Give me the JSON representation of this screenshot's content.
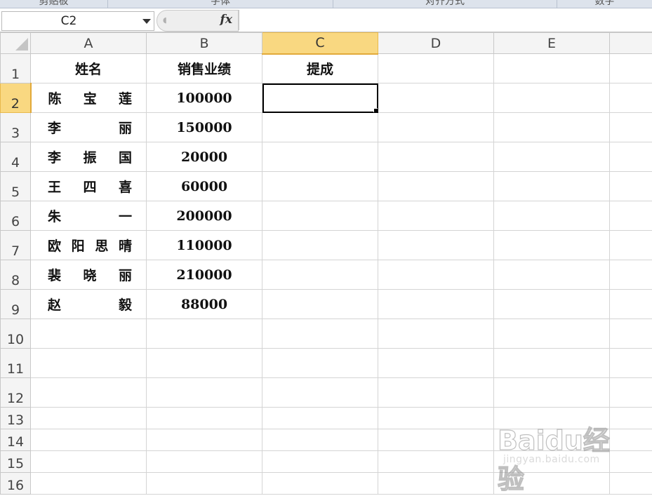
{
  "ribbon": {
    "groups": [
      "剪贴板",
      "字体",
      "对齐方式",
      "数字"
    ]
  },
  "formula_bar": {
    "name_box": "C2",
    "fx_label": "fx",
    "formula": ""
  },
  "grid": {
    "columns": [
      "A",
      "B",
      "C",
      "D",
      "E"
    ],
    "rows": [
      "1",
      "2",
      "3",
      "4",
      "5",
      "6",
      "7",
      "8",
      "9",
      "10",
      "11",
      "12",
      "13",
      "14",
      "15",
      "16"
    ],
    "active_cell": "C2",
    "header_row": {
      "name": "姓名",
      "sales": "销售业绩",
      "commission": "提成"
    },
    "data": [
      {
        "name": "陈宝莲",
        "sales": "100000"
      },
      {
        "name": "李丽",
        "sales": "150000"
      },
      {
        "name": "李振国",
        "sales": "20000"
      },
      {
        "name": "王四喜",
        "sales": "60000"
      },
      {
        "name": "朱一",
        "sales": "200000"
      },
      {
        "name": "欧阳思晴",
        "sales": "110000"
      },
      {
        "name": "裴晓丽",
        "sales": "210000"
      },
      {
        "name": "赵毅",
        "sales": "88000"
      }
    ]
  },
  "watermark": {
    "brand": "Baidu经验",
    "url": "jingyan.baidu.com"
  },
  "colors": {
    "active_header": "#f9d881",
    "header_bg": "#f4f4f4",
    "gridline": "#d4d4d4"
  }
}
